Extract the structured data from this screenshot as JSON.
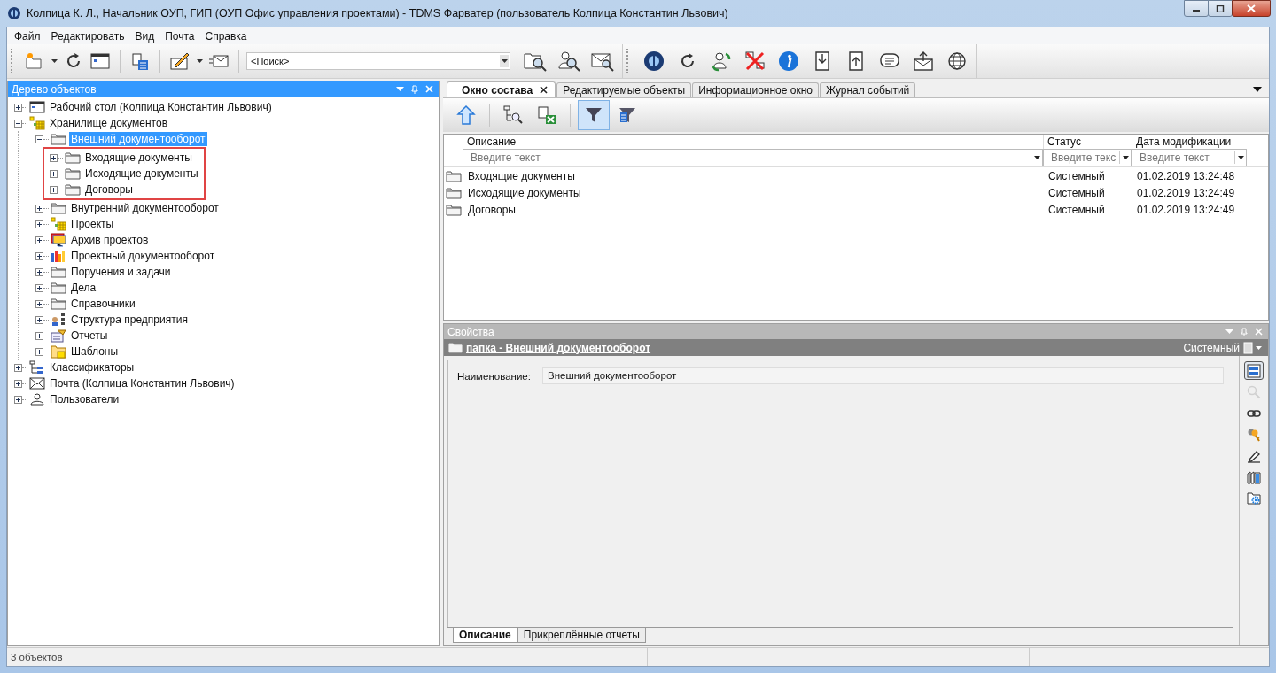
{
  "window": {
    "title": "Колпица К. Л., Начальник ОУП, ГИП (ОУП Офис управления проектами) - TDMS Фарватер (пользователь Колпица Константин Львович)"
  },
  "menu": [
    "Файл",
    "Редактировать",
    "Вид",
    "Почта",
    "Справка"
  ],
  "search": {
    "value": "<Поиск>"
  },
  "tree_panel": {
    "title": "Дерево объектов"
  },
  "tree": [
    {
      "label": "Рабочий стол (Колпица Константин Львович)",
      "kind": "desktop",
      "expanded": false,
      "selected": false
    },
    {
      "label": "Хранилище документов",
      "kind": "storage",
      "expanded": true,
      "selected": false,
      "children": [
        {
          "label": "Внешний документооборот",
          "kind": "folder",
          "expanded": true,
          "selected": true,
          "framed_children": true,
          "children": [
            {
              "label": "Входящие документы",
              "kind": "folder",
              "expanded": false,
              "selected": false
            },
            {
              "label": "Исходящие документы",
              "kind": "folder",
              "expanded": false,
              "selected": false
            },
            {
              "label": "Договоры",
              "kind": "folder",
              "expanded": false,
              "selected": false
            }
          ]
        },
        {
          "label": "Внутренний документооборот",
          "kind": "folder",
          "expanded": false,
          "selected": false
        },
        {
          "label": "Проекты",
          "kind": "storage",
          "expanded": false,
          "selected": false
        },
        {
          "label": "Архив проектов",
          "kind": "archive",
          "expanded": false,
          "selected": false
        },
        {
          "label": "Проектный документооборот",
          "kind": "chart",
          "expanded": false,
          "selected": false
        },
        {
          "label": "Поручения и задачи",
          "kind": "folder",
          "expanded": false,
          "selected": false
        },
        {
          "label": "Дела",
          "kind": "folder",
          "expanded": false,
          "selected": false
        },
        {
          "label": "Справочники",
          "kind": "folder",
          "expanded": false,
          "selected": false
        },
        {
          "label": "Структура предприятия",
          "kind": "structure",
          "expanded": false,
          "selected": false
        },
        {
          "label": "Отчеты",
          "kind": "reports",
          "expanded": false,
          "selected": false
        },
        {
          "label": "Шаблоны",
          "kind": "templates",
          "expanded": false,
          "selected": false
        }
      ]
    },
    {
      "label": "Классификаторы",
      "kind": "classifier",
      "expanded": false,
      "selected": false
    },
    {
      "label": "Почта (Колпица Константин Львович)",
      "kind": "mail",
      "expanded": false,
      "selected": false
    },
    {
      "label": "Пользователи",
      "kind": "users",
      "expanded": false,
      "selected": false
    }
  ],
  "tabs": [
    {
      "label": "Окно состава",
      "selected": true
    },
    {
      "label": "Редактируемые объекты",
      "selected": false
    },
    {
      "label": "Информационное окно",
      "selected": false
    },
    {
      "label": "Журнал событий",
      "selected": false
    }
  ],
  "content_toolbar": [
    {
      "kind": "up",
      "selected": false
    },
    {
      "kind": "find",
      "selected": false
    },
    {
      "kind": "excel",
      "selected": false
    },
    {
      "kind": "filter",
      "selected": true
    },
    {
      "kind": "filter-list",
      "selected": false
    }
  ],
  "table": {
    "columns": [
      {
        "label": "Описание",
        "placeholder": "Введите текст"
      },
      {
        "label": "Статус",
        "placeholder": "Введите текс"
      },
      {
        "label": "Дата модификации",
        "placeholder": "Введите текст"
      }
    ],
    "rows": [
      {
        "description": "Входящие документы",
        "status": "Системный",
        "modified": "01.02.2019 13:24:48"
      },
      {
        "description": "Исходящие документы",
        "status": "Системный",
        "modified": "01.02.2019 13:24:49"
      },
      {
        "description": "Договоры",
        "status": "Системный",
        "modified": "01.02.2019 13:24:49"
      }
    ]
  },
  "properties": {
    "title": "Свойства",
    "object": "папка - Внешний документооборот",
    "status": "Системный",
    "fields": [
      {
        "label": "Наименование:",
        "value": "Внешний документооборот"
      }
    ],
    "side_tools": [
      {
        "kind": "form",
        "selected": true,
        "disabled": false
      },
      {
        "kind": "search",
        "selected": false,
        "disabled": true
      },
      {
        "kind": "link",
        "selected": false,
        "disabled": false
      },
      {
        "kind": "keys",
        "selected": false,
        "disabled": false
      },
      {
        "kind": "pen",
        "selected": false,
        "disabled": false
      },
      {
        "kind": "books",
        "selected": false,
        "disabled": false
      },
      {
        "kind": "folder-gear",
        "selected": false,
        "disabled": false
      }
    ],
    "tabs": [
      {
        "label": "Описание",
        "selected": true
      },
      {
        "label": "Прикреплённые отчеты",
        "selected": false
      }
    ]
  },
  "status_bar": {
    "text": "3 объектов"
  }
}
